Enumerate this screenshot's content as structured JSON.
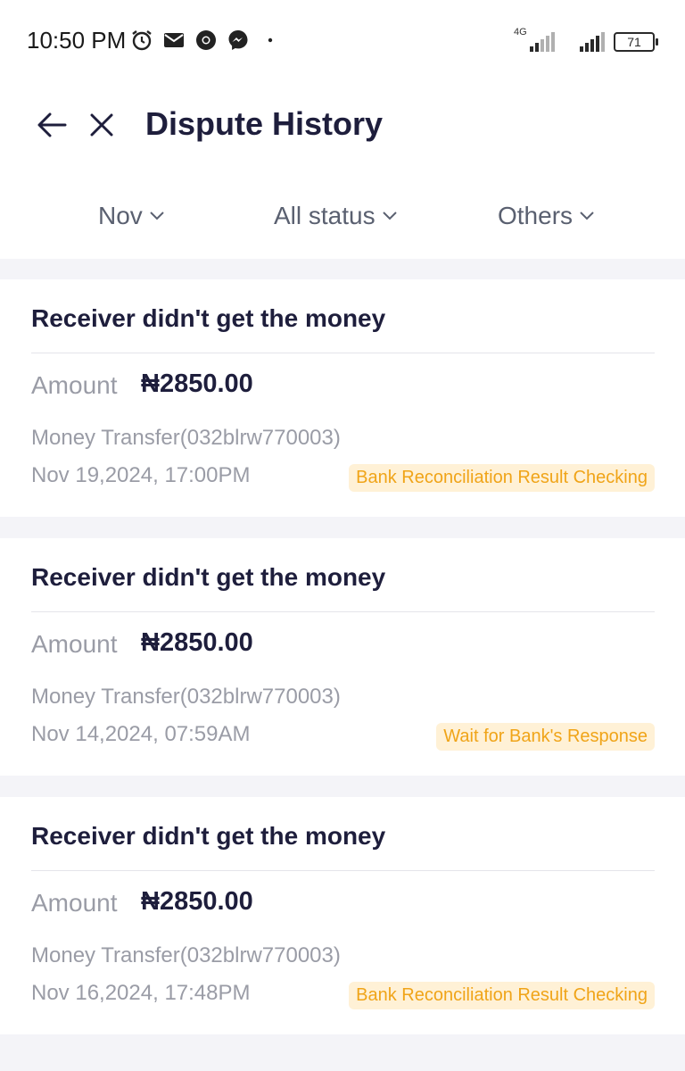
{
  "status_bar": {
    "time": "10:50 PM",
    "network_label": "4G",
    "battery": "71",
    "icons": [
      "alarm-icon",
      "mail-icon",
      "chrome-icon",
      "messenger-icon",
      "dot-icon"
    ]
  },
  "header": {
    "title": "Dispute History",
    "back_icon": "arrow-left-icon",
    "close_icon": "close-icon"
  },
  "filters": [
    {
      "label": "Nov"
    },
    {
      "label": "All status"
    },
    {
      "label": "Others"
    }
  ],
  "disputes": [
    {
      "title": "Receiver didn't get the money",
      "amount_label": "Amount",
      "amount": "₦2850.00",
      "description": "Money Transfer(032blrw770003)",
      "date": "Nov 19,2024, 17:00PM",
      "status": "Bank Reconciliation Result Checking"
    },
    {
      "title": "Receiver didn't get the money",
      "amount_label": "Amount",
      "amount": "₦2850.00",
      "description": "Money Transfer(032blrw770003)",
      "date": "Nov 14,2024, 07:59AM",
      "status": "Wait for Bank's Response"
    },
    {
      "title": "Receiver didn't get the money",
      "amount_label": "Amount",
      "amount": "₦2850.00",
      "description": "Money Transfer(032blrw770003)",
      "date": "Nov 16,2024, 17:48PM",
      "status": "Bank Reconciliation Result Checking"
    }
  ],
  "colors": {
    "title_text": "#1e1e3c",
    "muted_text": "#9a9ca6",
    "badge_text": "#f0a418",
    "badge_bg": "#fff1d6",
    "page_bg": "#f4f4f8"
  }
}
